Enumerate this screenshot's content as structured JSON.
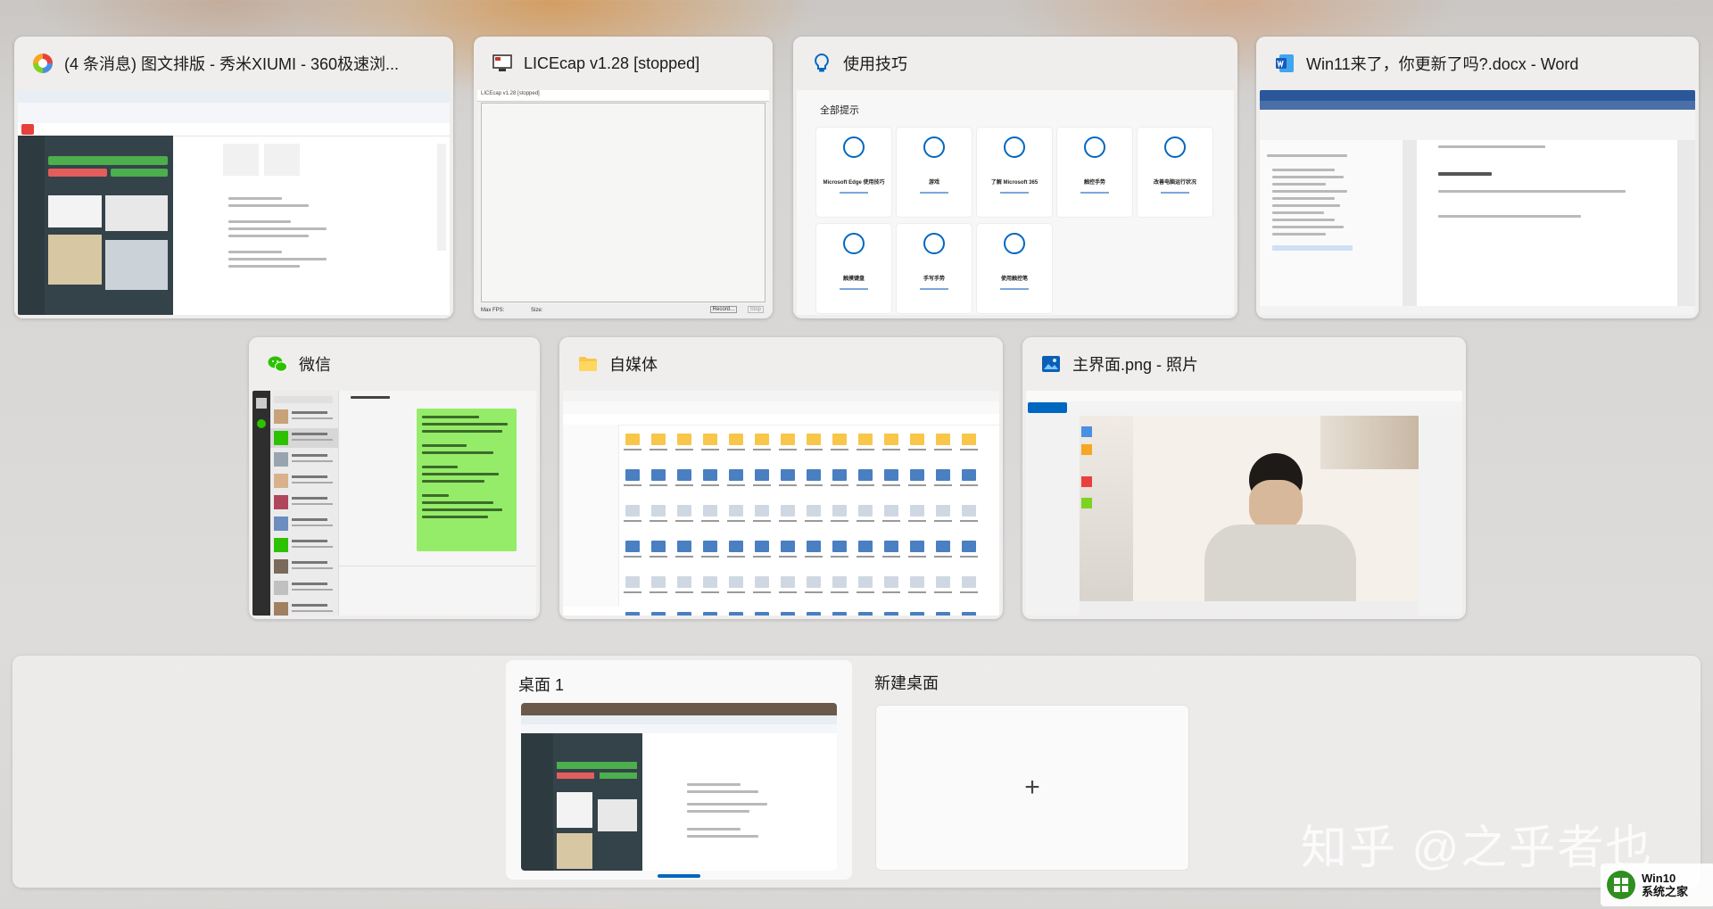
{
  "windows": [
    {
      "icon": "360-browser-icon",
      "title": "(4 条消息) 图文排版 - 秀米XIUMI - 360极速浏..."
    },
    {
      "icon": "licecap-icon",
      "title": "LICEcap v1.28 [stopped]"
    },
    {
      "icon": "tips-icon",
      "title": "使用技巧"
    },
    {
      "icon": "word-icon",
      "title": "Win11来了，你更新了吗?.docx - Word"
    },
    {
      "icon": "wechat-icon",
      "title": "微信"
    },
    {
      "icon": "folder-icon",
      "title": "自媒体"
    },
    {
      "icon": "photos-icon",
      "title": "主界面.png - 照片"
    }
  ],
  "tips_window": {
    "header": "全部提示",
    "cards": [
      "Microsoft Edge 使用技巧",
      "游戏",
      "了解 Microsoft 365",
      "触控手势",
      "改善电脑运行状况",
      "触摸键盘",
      "手写手势",
      "使用触控笔"
    ]
  },
  "licecap_window": {
    "inner_title": "LICEcap v1.28 [stopped]",
    "footer": [
      "Max FPS:",
      "Size:",
      "Record...",
      "Stop"
    ]
  },
  "desktops": {
    "current_label": "桌面 1",
    "new_label": "新建桌面",
    "plus": "+"
  },
  "watermark": "知乎 @之乎者也",
  "badge": {
    "line1": "Win10",
    "line2": "系统之家"
  },
  "colors": {
    "accent": "#0067c0",
    "wechat_green": "#95ec69",
    "wechat_sidebar": "#2e2e2e",
    "xiumi_sidebar": "#2d3a40",
    "xiumi_green": "#4cae4c",
    "word_blue": "#2b579a"
  }
}
